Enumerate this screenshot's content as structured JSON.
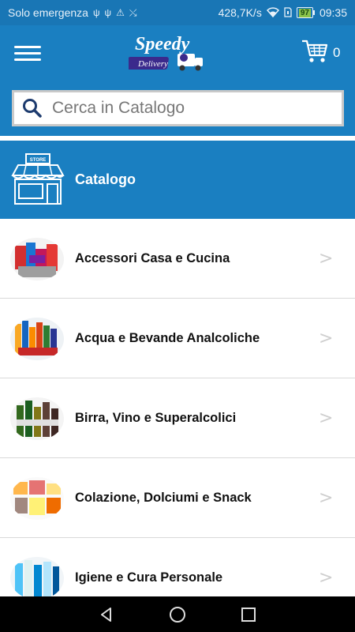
{
  "status_bar": {
    "carrier": "Solo emergenza",
    "net_speed": "428,7K/s",
    "battery": "97",
    "time": "09:35"
  },
  "app_bar": {
    "logo_text_main": "Speedy",
    "logo_text_sub": "Delivery",
    "cart_count": "0"
  },
  "search": {
    "placeholder": "Cerca in Catalogo"
  },
  "catalog": {
    "title": "Catalogo",
    "store_sign": "STORE"
  },
  "categories": [
    {
      "label": "Accessori Casa e Cucina"
    },
    {
      "label": "Acqua e Bevande Analcoliche"
    },
    {
      "label": "Birra, Vino e Superalcolici"
    },
    {
      "label": "Colazione, Dolciumi e Snack"
    },
    {
      "label": "Igiene e Cura Personale"
    }
  ],
  "chevron": ">",
  "colors": {
    "primary": "#1a7fc1",
    "status_bar": "#1976b5",
    "nav_bar": "#000000"
  }
}
